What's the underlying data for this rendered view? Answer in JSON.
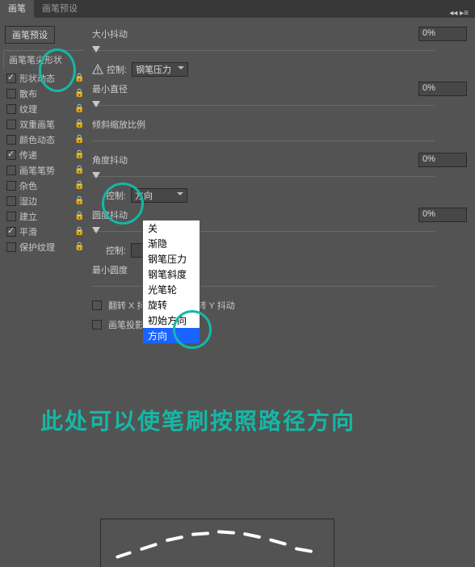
{
  "tabs": {
    "brush": "画笔",
    "preset": "画笔预设"
  },
  "sidebar": {
    "preset_btn": "画笔预设",
    "header": "画笔笔尖形状",
    "items": [
      {
        "label": "形状动态",
        "checked": true
      },
      {
        "label": "散布",
        "checked": false
      },
      {
        "label": "纹理",
        "checked": false
      },
      {
        "label": "双重画笔",
        "checked": false
      },
      {
        "label": "颜色动态",
        "checked": false
      },
      {
        "label": "传递",
        "checked": true
      },
      {
        "label": "画笔笔势",
        "checked": false
      },
      {
        "label": "杂色",
        "checked": false
      },
      {
        "label": "湿边",
        "checked": false
      },
      {
        "label": "建立",
        "checked": false
      },
      {
        "label": "平滑",
        "checked": true
      },
      {
        "label": "保护纹理",
        "checked": false
      }
    ]
  },
  "right": {
    "size_jitter": "大小抖动",
    "size_val": "0%",
    "control": "控制:",
    "pen_pressure": "钢笔压力",
    "min_diam": "最小直径",
    "min_val": "0%",
    "tilt_scale": "倾斜缩放比例",
    "angle_jitter": "角度抖动",
    "angle_val": "0%",
    "control2": "控制:",
    "direction": "方向",
    "round_jitter": "圆度抖动",
    "round_val": "0%",
    "control3": "控制:",
    "min_round": "最小圆度",
    "flip_x": "翻转 X 抖动",
    "flip_y": "翻转 Y 抖动",
    "brush_proj": "画笔投影"
  },
  "dropdown": {
    "options": [
      "关",
      "渐隐",
      "钢笔压力",
      "钢笔斜度",
      "光笔轮",
      "旋转",
      "初始方向",
      "方向"
    ],
    "selected": "方向"
  },
  "note": "此处可以使笔刷按照路径方向"
}
